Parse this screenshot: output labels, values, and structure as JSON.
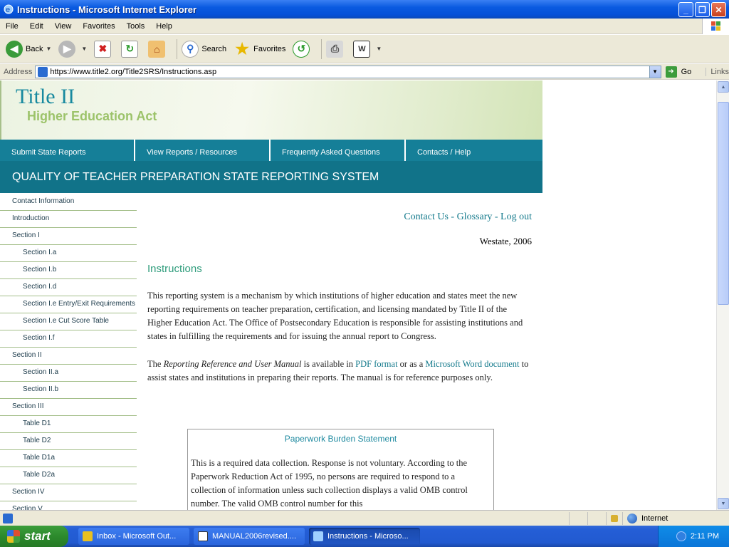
{
  "window": {
    "title": "Instructions - Microsoft Internet Explorer",
    "min": "_",
    "max": "❐",
    "close": "✕"
  },
  "menu": [
    "File",
    "Edit",
    "View",
    "Favorites",
    "Tools",
    "Help"
  ],
  "toolbar": {
    "back": "Back",
    "search": "Search",
    "favorites": "Favorites"
  },
  "address": {
    "label": "Address",
    "url": "https://www.title2.org/Title2SRS/Instructions.asp",
    "go": "Go",
    "links": "Links"
  },
  "banner": {
    "title": "Title II",
    "subtitle": "Higher Education Act"
  },
  "nav": [
    "Submit State Reports",
    "View Reports / Resources",
    "Frequently Asked Questions",
    "Contacts / Help"
  ],
  "system_title": "QUALITY OF TEACHER PREPARATION STATE REPORTING SYSTEM",
  "sidebar": [
    {
      "label": "Contact Information",
      "sub": false
    },
    {
      "label": "Introduction",
      "sub": false
    },
    {
      "label": "Section I",
      "sub": false
    },
    {
      "label": "Section I.a",
      "sub": true
    },
    {
      "label": "Section I.b",
      "sub": true
    },
    {
      "label": "Section I.d",
      "sub": true
    },
    {
      "label": "Section I.e Entry/Exit Requirements",
      "sub": true
    },
    {
      "label": "Section I.e Cut Score Table",
      "sub": true
    },
    {
      "label": "Section I.f",
      "sub": true
    },
    {
      "label": "Section II",
      "sub": false
    },
    {
      "label": "Section II.a",
      "sub": true
    },
    {
      "label": "Section II.b",
      "sub": true
    },
    {
      "label": "Section III",
      "sub": false
    },
    {
      "label": "Table D1",
      "sub": true
    },
    {
      "label": "Table D2",
      "sub": true
    },
    {
      "label": "Table D1a",
      "sub": true
    },
    {
      "label": "Table D2a",
      "sub": true
    },
    {
      "label": "Section IV",
      "sub": false
    },
    {
      "label": "Section V",
      "sub": false
    }
  ],
  "content": {
    "links": {
      "contact": "Contact Us",
      "glossary": "Glossary",
      "logout": "Log out",
      "sep": " - "
    },
    "westate": "Westate, 2006",
    "heading": "Instructions",
    "para1": "This reporting system is a mechanism by which institutions of higher education and states meet the new reporting requirements on teacher preparation, certification, and licensing mandated by Title II of the Higher Education Act. The Office of Postsecondary Education is responsible for assisting institutions and states in fulfilling the requirements and for issuing the annual report to Congress.",
    "para2": {
      "p1": "The ",
      "manual": "Reporting Reference and User Manual",
      "p2": " is available in ",
      "pdf": "PDF format",
      "p3": " or as a ",
      "word": "Microsoft Word document",
      "p4": " to assist states and institutions in preparing their reports. The manual is for reference purposes only."
    },
    "paperwork": {
      "title": "Paperwork Burden Statement",
      "body": "This is a required data collection. Response is not voluntary. According to the Paperwork Reduction Act of 1995, no persons are required to respond to a collection of information unless such collection displays a valid OMB control number. The valid OMB control number for this"
    }
  },
  "status": {
    "zone": "Internet"
  },
  "taskbar": {
    "start": "start",
    "tasks": [
      "Inbox - Microsoft Out...",
      "MANUAL2006revised....",
      "Instructions - Microso..."
    ],
    "clock": "2:11 PM"
  }
}
